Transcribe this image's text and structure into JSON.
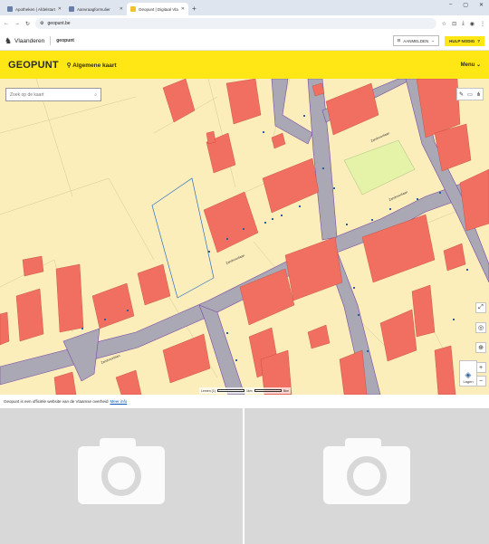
{
  "browser": {
    "tabs": [
      {
        "label": "Apotheken | Afdelstart",
        "active": false
      },
      {
        "label": "Aanvraagformulier",
        "active": false
      },
      {
        "label": "Geopunt | Digitaal Vlaanderen",
        "active": true
      }
    ],
    "new_tab_symbol": "+",
    "url": "geopunt.be",
    "window_controls": [
      "–",
      "▢",
      "✕"
    ]
  },
  "site_header": {
    "org_name": "Vlaanderen",
    "site_name": "geopunt",
    "login_label": "AANMELDEN",
    "help_label": "HULP NODIG"
  },
  "geopunt_bar": {
    "logo": "GEOPUNT",
    "map_title": "Algemene kaart",
    "menu_label": "Menu"
  },
  "map": {
    "search_placeholder": "Zoek op de kaart",
    "street_labels": [
      "Zandvoortlaan",
      "Zandvoortlaan",
      "Zandvoortlaan",
      "Zandvoortlaan"
    ],
    "scale_label": "Lemen (1)",
    "scale_label_mid": "1km",
    "scale_label_end": "5km",
    "layers_label": "Lagen",
    "colors": {
      "land": "#fbeebb",
      "building": "#f06f61",
      "road": "#a9a8b4",
      "road_edge": "#7c4aa8",
      "green": "#e4f3a7",
      "parcel_highlight": "#2e6fc4"
    }
  },
  "footer": {
    "text": "Geopunt is een officiële website van de Vlaamse overheid",
    "link": "Meer info"
  },
  "placeholders": [
    {
      "icon": "camera-icon"
    },
    {
      "icon": "camera-icon"
    }
  ]
}
